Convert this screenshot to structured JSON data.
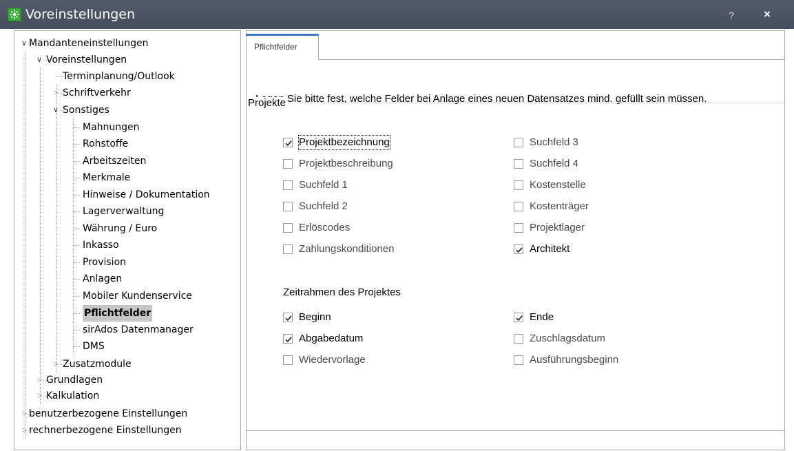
{
  "window": {
    "title": "Voreinstellungen",
    "help_label": "?",
    "close_label": "×"
  },
  "tree": {
    "items": [
      {
        "label": "Mandanteneinstellungen",
        "expanded": true
      },
      {
        "label": "Voreinstellungen",
        "expanded": true
      },
      {
        "label": "Terminplanung/Outlook"
      },
      {
        "label": "Schriftverkehr",
        "expanded": false
      },
      {
        "label": "Sonstiges",
        "expanded": true
      },
      {
        "label": "Mahnungen"
      },
      {
        "label": "Rohstoffe"
      },
      {
        "label": "Arbeitszeiten"
      },
      {
        "label": "Merkmale"
      },
      {
        "label": "Hinweise / Dokumentation"
      },
      {
        "label": "Lagerverwaltung"
      },
      {
        "label": "Währung / Euro"
      },
      {
        "label": "Inkasso"
      },
      {
        "label": "Provision"
      },
      {
        "label": "Anlagen"
      },
      {
        "label": "Mobiler Kundenservice"
      },
      {
        "label": "Pflichtfelder",
        "selected": true
      },
      {
        "label": "sirAdos Datenmanager"
      },
      {
        "label": "DMS"
      },
      {
        "label": "Zusatzmodule",
        "expanded": false
      },
      {
        "label": "Grundlagen",
        "expanded": false
      },
      {
        "label": "Kalkulation",
        "expanded": false
      },
      {
        "label": "benutzerbezogene Einstellungen",
        "expanded": false
      },
      {
        "label": "rechnerbezogene Einstellungen",
        "expanded": false
      }
    ]
  },
  "tab": {
    "label": "Pflichtfelder"
  },
  "content": {
    "intro": "Legen Sie bitte fest, welche Felder bei Anlage eines neuen Datensatzes mind. gefüllt sein müssen.",
    "group_title": "Projekte",
    "left_fields": [
      {
        "label": "Projektbezeichnung",
        "checked": true
      },
      {
        "label": "Projektbeschreibung",
        "checked": false
      },
      {
        "label": "Suchfeld 1",
        "checked": false
      },
      {
        "label": "Suchfeld 2",
        "checked": false
      },
      {
        "label": "Erlöscodes",
        "checked": false
      },
      {
        "label": "Zahlungskonditionen",
        "checked": false
      }
    ],
    "right_fields": [
      {
        "label": "Suchfeld 3",
        "checked": false
      },
      {
        "label": "Suchfeld 4",
        "checked": false
      },
      {
        "label": "Kostenstelle",
        "checked": false
      },
      {
        "label": "Kostenträger",
        "checked": false
      },
      {
        "label": "Projektlager",
        "checked": false
      },
      {
        "label": "Architekt",
        "checked": true
      }
    ],
    "time_title": "Zeitrahmen des Projektes",
    "time_left": [
      {
        "label": "Beginn",
        "checked": true
      },
      {
        "label": "Abgabedatum",
        "checked": true
      },
      {
        "label": "Wiedervorlage",
        "checked": false
      }
    ],
    "time_right": [
      {
        "label": "Ende",
        "checked": true
      },
      {
        "label": "Zuschlagsdatum",
        "checked": false
      },
      {
        "label": "Ausführungsbeginn",
        "checked": false
      }
    ]
  },
  "colors": {
    "titlebar": "#4a5568",
    "tab_accent": "#3d79c4",
    "selection": "#c6c6c6",
    "app_icon": "#3aa83a"
  },
  "icons": {
    "app": "app-icon",
    "help": "help-icon",
    "close": "close-icon",
    "expanded": "chevron-down-icon",
    "collapsed": "chevron-right-icon",
    "checkmark": "checkmark-icon"
  }
}
